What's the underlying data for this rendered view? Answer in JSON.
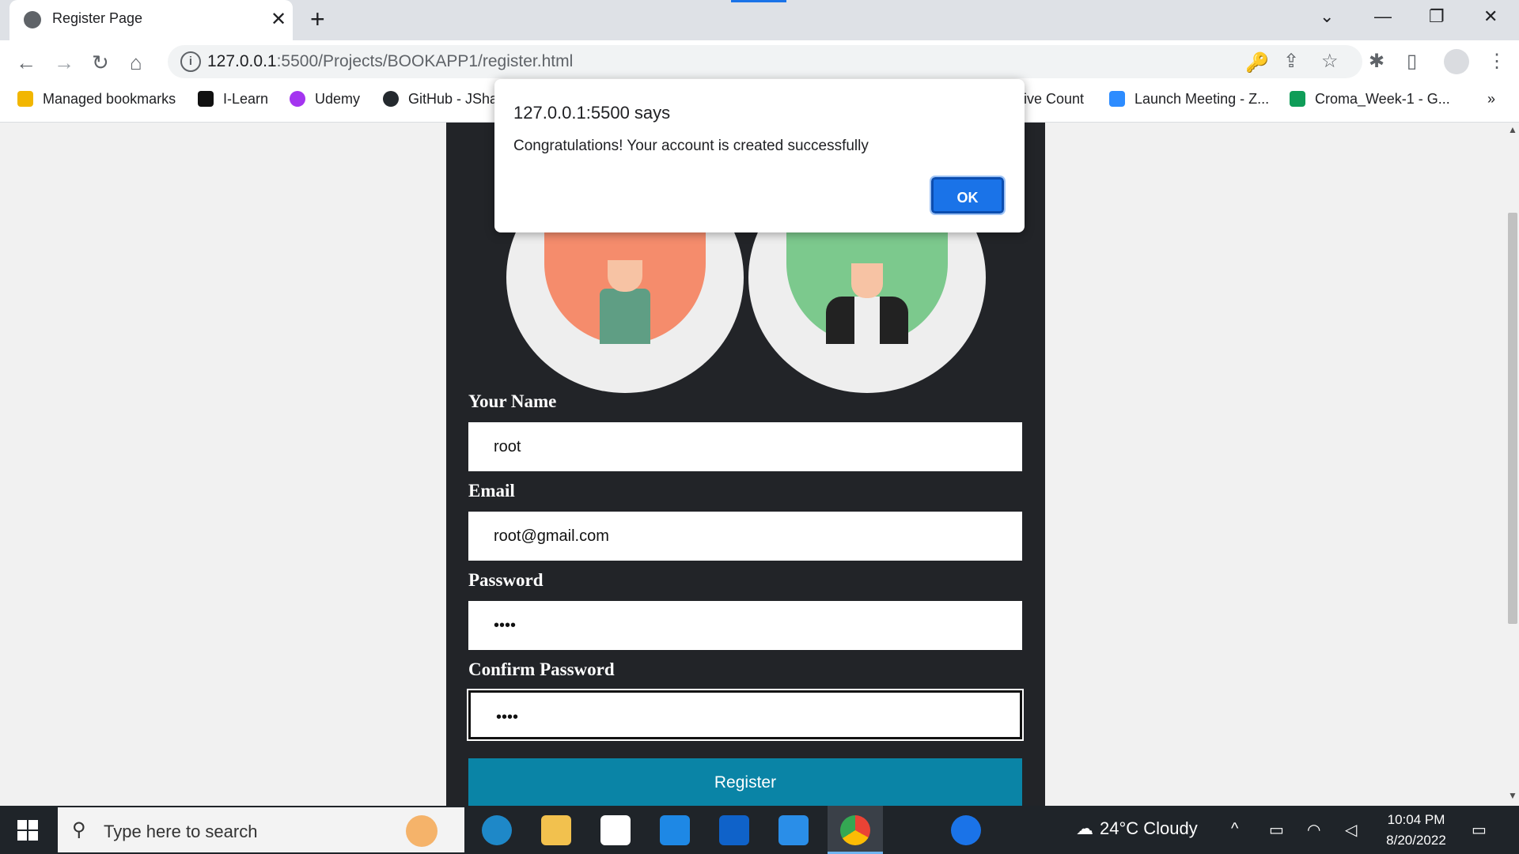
{
  "tab": {
    "title": "Register Page",
    "close": "✕"
  },
  "new_tab": "+",
  "window_controls": {
    "dropdown": "⌄",
    "minimize": "—",
    "restore": "❐",
    "close": "✕"
  },
  "nav": {
    "back": "←",
    "forward": "→",
    "reload": "↻",
    "home": "⌂"
  },
  "address_bar": {
    "host": "127.0.0.1",
    "path": ":5500/Projects/BOOKAPP1/register.html"
  },
  "toolbar_icons": {
    "key": "🔑",
    "share": "⇪",
    "star": "☆",
    "extensions": "✱",
    "sidepanel": "▯",
    "menu": "⋮"
  },
  "bookmarks": [
    {
      "label": "Managed bookmarks",
      "color": "#f2b600"
    },
    {
      "label": "I-Learn",
      "color": "#111111"
    },
    {
      "label": "Udemy",
      "color": "#a435f0"
    },
    {
      "label": "GitHub - JSha",
      "color": "#24292e"
    },
    {
      "label": "ive Count",
      "color": "#ffffff"
    },
    {
      "label": "Launch Meeting - Z...",
      "color": "#2d8cff"
    },
    {
      "label": "Croma_Week-1 - G...",
      "color": "#0f9d58"
    }
  ],
  "bookmarks_overflow": "»",
  "form": {
    "name_label": "Your Name",
    "name_value": "root",
    "email_label": "Email",
    "email_value": "root@gmail.com",
    "password_label": "Password",
    "password_value": "••••",
    "confirm_label": "Confirm Password",
    "confirm_value": "••••",
    "register_label": "Register"
  },
  "dialog": {
    "title": "127.0.0.1:5500 says",
    "message": "Congratulations! Your account is created successfully",
    "ok_label": "OK"
  },
  "taskbar": {
    "search_placeholder": "Type here to search",
    "weather": "24°C  Cloudy",
    "time": "10:04 PM",
    "date": "8/20/2022"
  },
  "colors": {
    "card_bg": "#222428",
    "register_button": "#0a84a6",
    "dialog_ok": "#1a73e8",
    "avatar_left": "#f58c6c",
    "avatar_right": "#7cc98d"
  }
}
